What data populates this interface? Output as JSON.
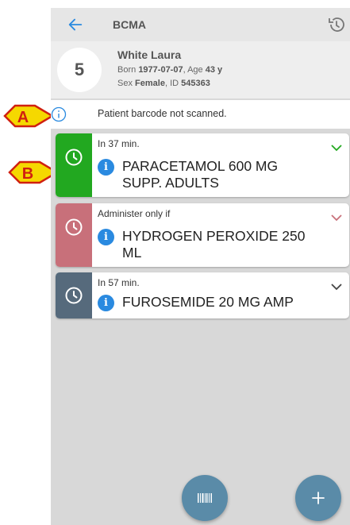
{
  "app": {
    "title": "BCMA",
    "back_icon": "arrow-left-icon",
    "history_icon": "history-icon"
  },
  "patient": {
    "bed": "5",
    "name": "White Laura",
    "born_label": "Born",
    "born_value": "1977-07-07",
    "age_label": ", Age",
    "age_value": "43 y",
    "sex_label": "Sex",
    "sex_value": "Female",
    "id_label": ", ID",
    "id_value": "545363"
  },
  "notice": {
    "icon": "info-outline-icon",
    "text": "Patient barcode not scanned."
  },
  "cards": [
    {
      "when": "In 37 min.",
      "drug": "PARACETAMOL 600 MG SUPP. ADULTS",
      "strip_color": "#22a820",
      "chevron_color": "#22a820"
    },
    {
      "when": "Administer only if",
      "drug": "HYDROGEN PEROXIDE 250 ML",
      "strip_color": "#c8707a",
      "chevron_color": "#c8707a"
    },
    {
      "when": "In 57 min.",
      "drug": "FUROSEMIDE 20 MG AMP",
      "strip_color": "#566a7c",
      "chevron_color": "#444444"
    }
  ],
  "info_glyph": "i",
  "fabs": {
    "scan_icon": "barcode-icon",
    "add_icon": "plus-icon",
    "color": "#5a8ba8"
  },
  "callouts": {
    "a": "A",
    "b": "B",
    "color": "#f5d800",
    "border": "#d02010"
  }
}
